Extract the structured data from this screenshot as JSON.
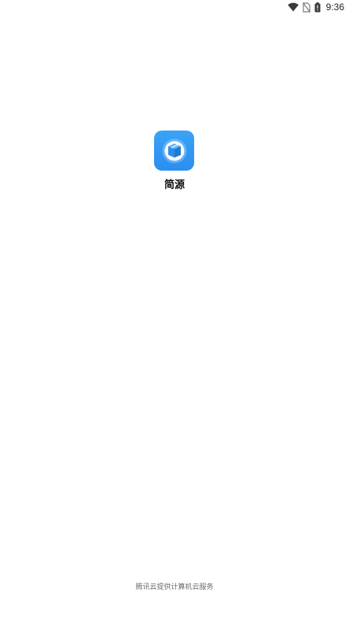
{
  "status_bar": {
    "time": "9:36",
    "icons": [
      "wifi-icon",
      "no-sim-icon",
      "battery-icon"
    ]
  },
  "splash": {
    "app_icon": "cube-box-icon",
    "app_name": "简源",
    "accent_color": "#2f95f3"
  },
  "footer": {
    "credit": "腾讯云提供计算机云服务"
  }
}
